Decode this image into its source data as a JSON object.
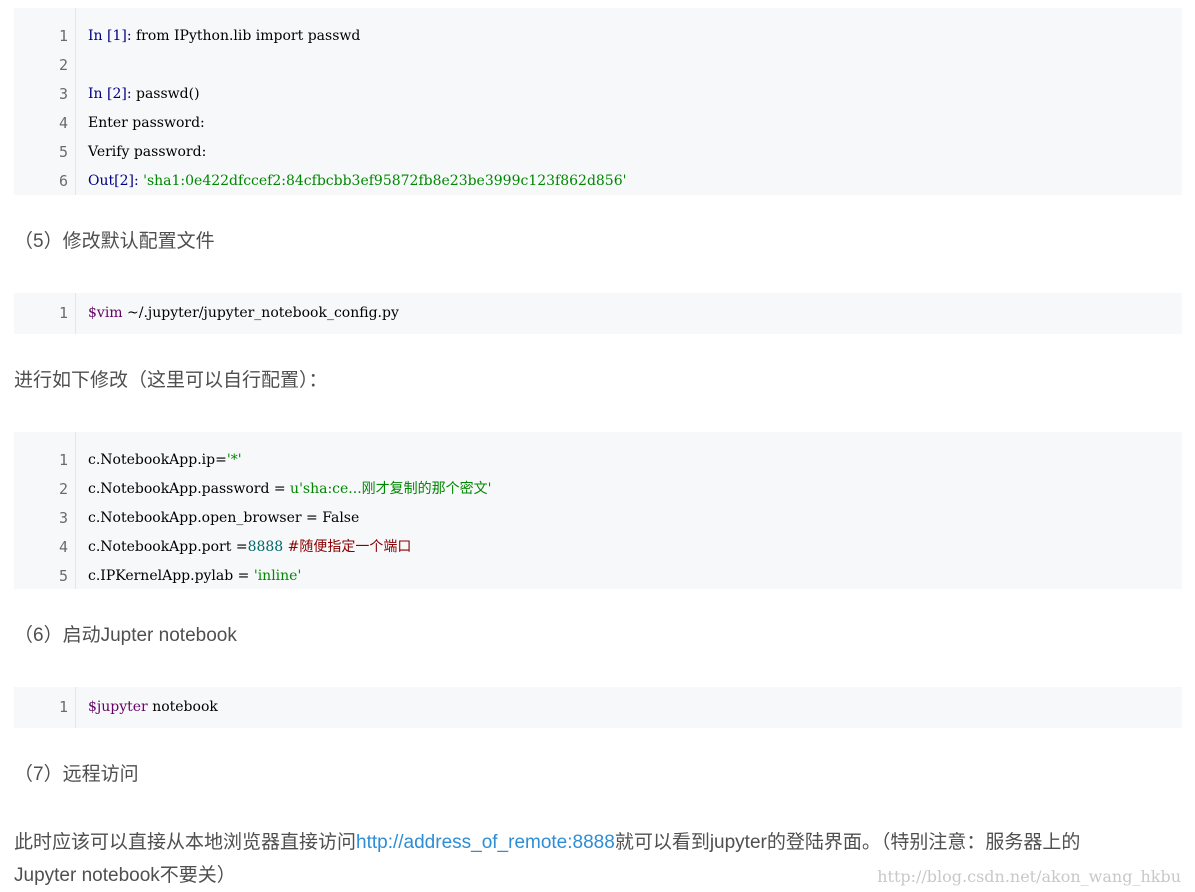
{
  "block1": {
    "line_numbers": [
      "1",
      "2",
      "3",
      "4",
      "5",
      "6"
    ],
    "lines": [
      {
        "pre": "In [1]: ",
        "main": "from IPython.lib import passwd"
      },
      {
        "pre": "",
        "main": ""
      },
      {
        "pre": "In [2]: ",
        "main": "passwd()"
      },
      {
        "pre": "",
        "main": "Enter password:"
      },
      {
        "pre": "",
        "main": "Verify password:"
      },
      {
        "pre": "Out[2]: ",
        "main": "'sha1:0e422dfccef2:84cfbcbb3ef95872fb8e23be3999c123f862d856'"
      }
    ]
  },
  "heading5": "（5）修改默认配置文件",
  "block2": {
    "line_numbers": [
      "1"
    ],
    "line1_var": "$vim",
    "line1_rest": " ~/.jupyter/jupyter_notebook_config.py"
  },
  "para_modify": "进行如下修改（这里可以自行配置）：",
  "block3": {
    "line_numbers": [
      "1",
      "2",
      "3",
      "4",
      "5"
    ],
    "l1_code": "c.NotebookApp.ip=",
    "l1_str": "'*'",
    "l2_code": "c.NotebookApp.password = ",
    "l2_str": "u'sha:ce...刚才复制的那个密文'",
    "l3_code": "c.NotebookApp.open_browser = False",
    "l4_code": "c.NotebookApp.port =",
    "l4_num": "8888",
    "l4_cmt": " #随便指定一个端口",
    "l5_code": "c.IPKernelApp.pylab = ",
    "l5_str": "'inline'"
  },
  "heading6": "（6）启动Jupter notebook",
  "block4": {
    "line_numbers": [
      "1"
    ],
    "line1_var": "$jupyter",
    "line1_rest": " notebook"
  },
  "heading7": "（7）远程访问",
  "para_access": {
    "before": "此时应该可以直接从本地浏览器直接访问",
    "link": "http://address_of_remote:8888",
    "after": "就可以看到jupyter的登陆界面。（特别注意：服务器上的",
    "line2": "Jupyter notebook不要关）"
  },
  "watermark": "http://blog.csdn.net/akon_wang_hkbu"
}
